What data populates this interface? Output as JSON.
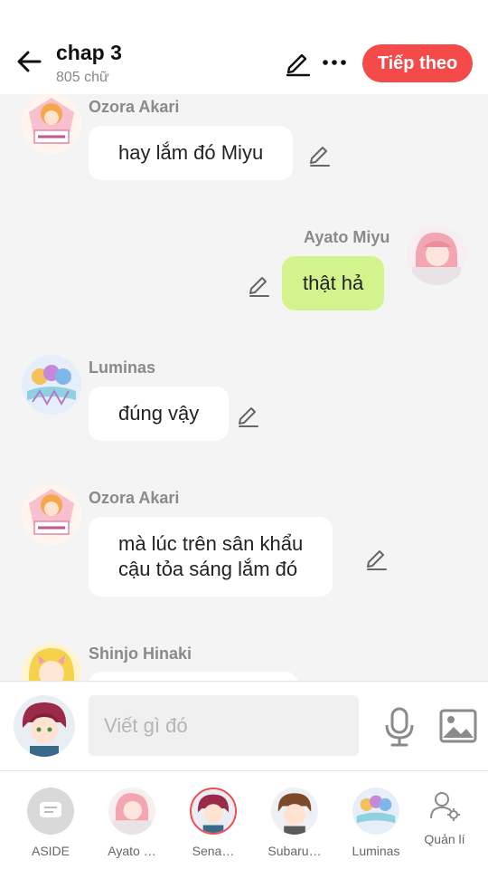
{
  "header": {
    "title": "chap 3",
    "word_count": "805 chữ",
    "next_label": "Tiếp theo"
  },
  "messages": [
    {
      "sender": "Ozora Akari",
      "text": "hay lắm đó Miyu",
      "side": "left"
    },
    {
      "sender": "Ayato  Miyu",
      "text": "thật hả",
      "side": "right"
    },
    {
      "sender": "Luminas",
      "text": "đúng vậy",
      "side": "left"
    },
    {
      "sender": "Ozora Akari",
      "text_lines": [
        "mà lúc trên sân khẩu",
        "cậu tỏa sáng lắm đó"
      ],
      "side": "left"
    },
    {
      "sender": "Shinjo Hinaki",
      "text": "",
      "side": "left"
    }
  ],
  "composer": {
    "placeholder": "Viết gì đó"
  },
  "bottom_bar": {
    "items": [
      {
        "label": "ASIDE"
      },
      {
        "label": "Ayato …"
      },
      {
        "label": "Sena…"
      },
      {
        "label": "Subaru…"
      },
      {
        "label": "Luminas"
      },
      {
        "label": "Quản lí"
      }
    ]
  },
  "colors": {
    "accent": "#f44a4a",
    "my_bubble": "#d3f38c",
    "background": "#f4f4f4"
  },
  "icons": [
    "back-arrow-icon",
    "edit-pencil-icon",
    "more-dots-icon",
    "microphone-icon",
    "image-icon",
    "manage-user-icon",
    "aside-chat-icon"
  ]
}
